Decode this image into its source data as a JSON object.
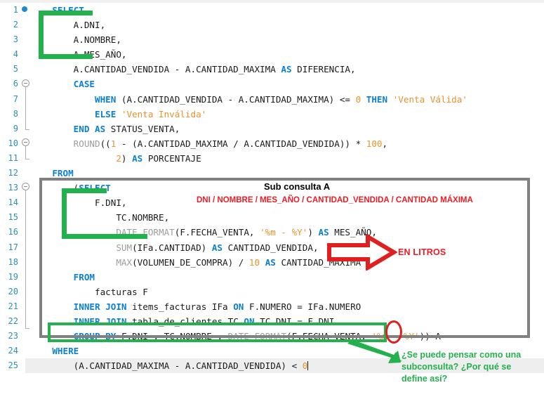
{
  "editor": {
    "app": "sql-code-editor",
    "language": "SQL",
    "current_line": 25,
    "breakpoint_line": 1,
    "lines": [
      {
        "n": 1,
        "indent": 1,
        "text": "SELECT"
      },
      {
        "n": 2,
        "indent": 2,
        "text": "A.DNI,"
      },
      {
        "n": 3,
        "indent": 2,
        "text": "A.NOMBRE,"
      },
      {
        "n": 4,
        "indent": 2,
        "text": "A.MES_AÑO,"
      },
      {
        "n": 5,
        "indent": 2,
        "text": "A.CANTIDAD_VENDIDA - A.CANTIDAD_MAXIMA AS DIFERENCIA,"
      },
      {
        "n": 6,
        "indent": 2,
        "text": "CASE"
      },
      {
        "n": 7,
        "indent": 3,
        "text": "WHEN (A.CANTIDAD_VENDIDA - A.CANTIDAD_MAXIMA) <= 0 THEN 'Venta Válida'"
      },
      {
        "n": 8,
        "indent": 3,
        "text": "ELSE 'Venta Inválida'"
      },
      {
        "n": 9,
        "indent": 2,
        "text": "END AS STATUS_VENTA,"
      },
      {
        "n": 10,
        "indent": 2,
        "text": "ROUND((1 - (A.CANTIDAD_MAXIMA / A.CANTIDAD_VENDIDA)) * 100,"
      },
      {
        "n": 11,
        "indent": 4,
        "text": "2) AS PORCENTAJE"
      },
      {
        "n": 12,
        "indent": 1,
        "text": "FROM"
      },
      {
        "n": 13,
        "indent": 2,
        "text": "(SELECT"
      },
      {
        "n": 14,
        "indent": 3,
        "text": "F.DNI,"
      },
      {
        "n": 15,
        "indent": 4,
        "text": "TC.NOMBRE,"
      },
      {
        "n": 16,
        "indent": 4,
        "text": "DATE_FORMAT(F.FECHA_VENTA, '%m - %Y') AS MES_AÑO,"
      },
      {
        "n": 17,
        "indent": 4,
        "text": "SUM(IFa.CANTIDAD) AS CANTIDAD_VENDIDA,"
      },
      {
        "n": 18,
        "indent": 4,
        "text": "MAX(VOLUMEN_DE_COMPRA) / 10 AS CANTIDAD_MAXIMA"
      },
      {
        "n": 19,
        "indent": 2,
        "text": "FROM"
      },
      {
        "n": 20,
        "indent": 3,
        "text": "facturas F"
      },
      {
        "n": 21,
        "indent": 2,
        "text": "INNER JOIN items_facturas IFa ON F.NUMERO = IFa.NUMERO"
      },
      {
        "n": 22,
        "indent": 2,
        "text": "INNER JOIN tabla_de_clientes TC ON TC.DNI = F.DNI"
      },
      {
        "n": 23,
        "indent": 2,
        "text": "GROUP BY F.DNI , TC.NOMBRE , DATE_FORMAT(F.FECHA_VENTA, '%m - %Y')) A"
      },
      {
        "n": 24,
        "indent": 1,
        "text": "WHERE"
      },
      {
        "n": 25,
        "indent": 2,
        "text": "(A.CANTIDAD_MAXIMA - A.CANTIDAD_VENDIDA) < 0"
      }
    ]
  },
  "annotations": {
    "subquery_title": "Sub consulta A",
    "subquery_columns": "DNI / NOMBRE / MES_AÑO / CANTIDAD_VENDIDA / CANTIDAD MÁXIMA",
    "en_litros": "EN LITROS",
    "question_line1": "¿Se puede pensar como una",
    "question_line2": "subconsulta? ¿Por qué se",
    "question_line3": "define así?",
    "alias_circled": "A"
  },
  "colors": {
    "keyword": "#0a7fd4",
    "string": "#e8932b",
    "function": "#9c9c9c",
    "line_number": "#2b91af",
    "highlight_green": "#22b14c",
    "highlight_red": "#ed1c24",
    "box_gray": "#808080",
    "current_line_bg": "#eeeeee",
    "breakpoint": "#1f8ad2"
  }
}
